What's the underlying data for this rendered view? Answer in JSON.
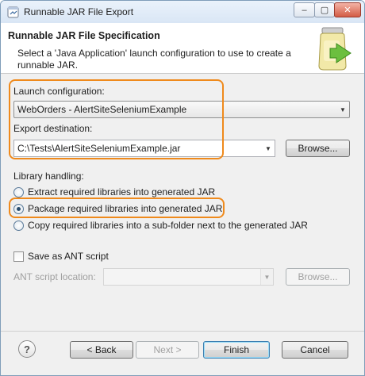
{
  "window": {
    "title": "Runnable JAR File Export",
    "min_glyph": "–",
    "max_glyph": "▢",
    "close_glyph": "✕"
  },
  "header": {
    "title": "Runnable JAR File Specification",
    "description": "Select a 'Java Application' launch configuration to use to create a runnable JAR."
  },
  "launch": {
    "label": "Launch configuration:",
    "value": "WebOrders - AlertSiteSeleniumExample"
  },
  "export": {
    "label": "Export destination:",
    "value": "C:\\Tests\\AlertSiteSeleniumExample.jar",
    "browse_label": "Browse..."
  },
  "library": {
    "label": "Library handling:",
    "options": [
      {
        "label": "Extract required libraries into generated JAR",
        "selected": false
      },
      {
        "label": "Package required libraries into generated JAR",
        "selected": true
      },
      {
        "label": "Copy required libraries into a sub-folder next to the generated JAR",
        "selected": false
      }
    ]
  },
  "ant": {
    "checkbox_label": "Save as ANT script",
    "checked": false,
    "location_label": "ANT script location:",
    "location_value": "",
    "browse_label": "Browse..."
  },
  "footer": {
    "help_label": "?",
    "back_label": "< Back",
    "next_label": "Next >",
    "finish_label": "Finish",
    "cancel_label": "Cancel"
  },
  "colors": {
    "highlight": "#ef8a1c",
    "default_button_border": "#3c7fb1"
  }
}
